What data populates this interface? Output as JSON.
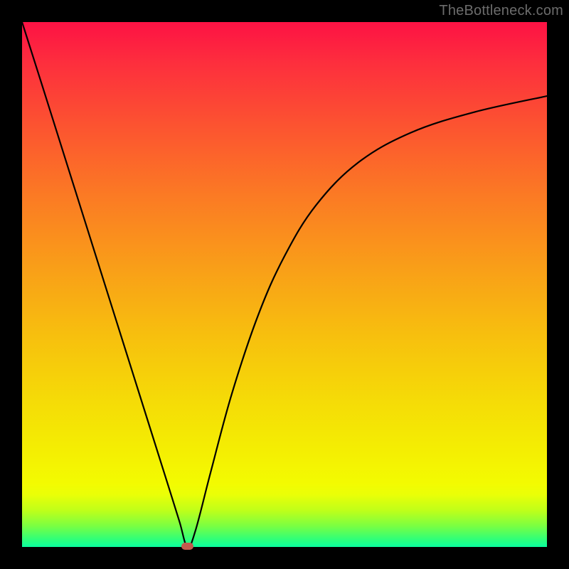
{
  "watermark": "TheBottleneck.com",
  "chart_data": {
    "type": "line",
    "title": "",
    "xlabel": "",
    "ylabel": "",
    "xlim": [
      0,
      100
    ],
    "ylim": [
      0,
      100
    ],
    "grid": false,
    "legend": false,
    "background_gradient": {
      "stops": [
        {
          "pos": 0.0,
          "color": "#fd1244"
        },
        {
          "pos": 0.5,
          "color": "#f8b012"
        },
        {
          "pos": 0.88,
          "color": "#f3fb01"
        },
        {
          "pos": 1.0,
          "color": "#0aff9f"
        }
      ],
      "direction": "top-to-bottom"
    },
    "series": [
      {
        "name": "bottleneck-curve",
        "color": "#000000",
        "x": [
          0,
          4,
          8,
          12,
          16,
          20,
          24,
          28,
          30,
          31.5,
          33,
          36,
          40,
          45,
          50,
          56,
          64,
          74,
          86,
          100
        ],
        "y": [
          100,
          87.4,
          74.7,
          62.0,
          49.3,
          36.6,
          23.9,
          11.2,
          4.8,
          0,
          3.0,
          14.5,
          29.3,
          44.2,
          55.4,
          65.1,
          73.2,
          78.9,
          82.8,
          85.9
        ]
      }
    ],
    "annotations": [
      {
        "name": "min-marker",
        "shape": "rounded-rect",
        "color": "#c35a4d",
        "x": 31.5,
        "y": 0
      }
    ]
  }
}
